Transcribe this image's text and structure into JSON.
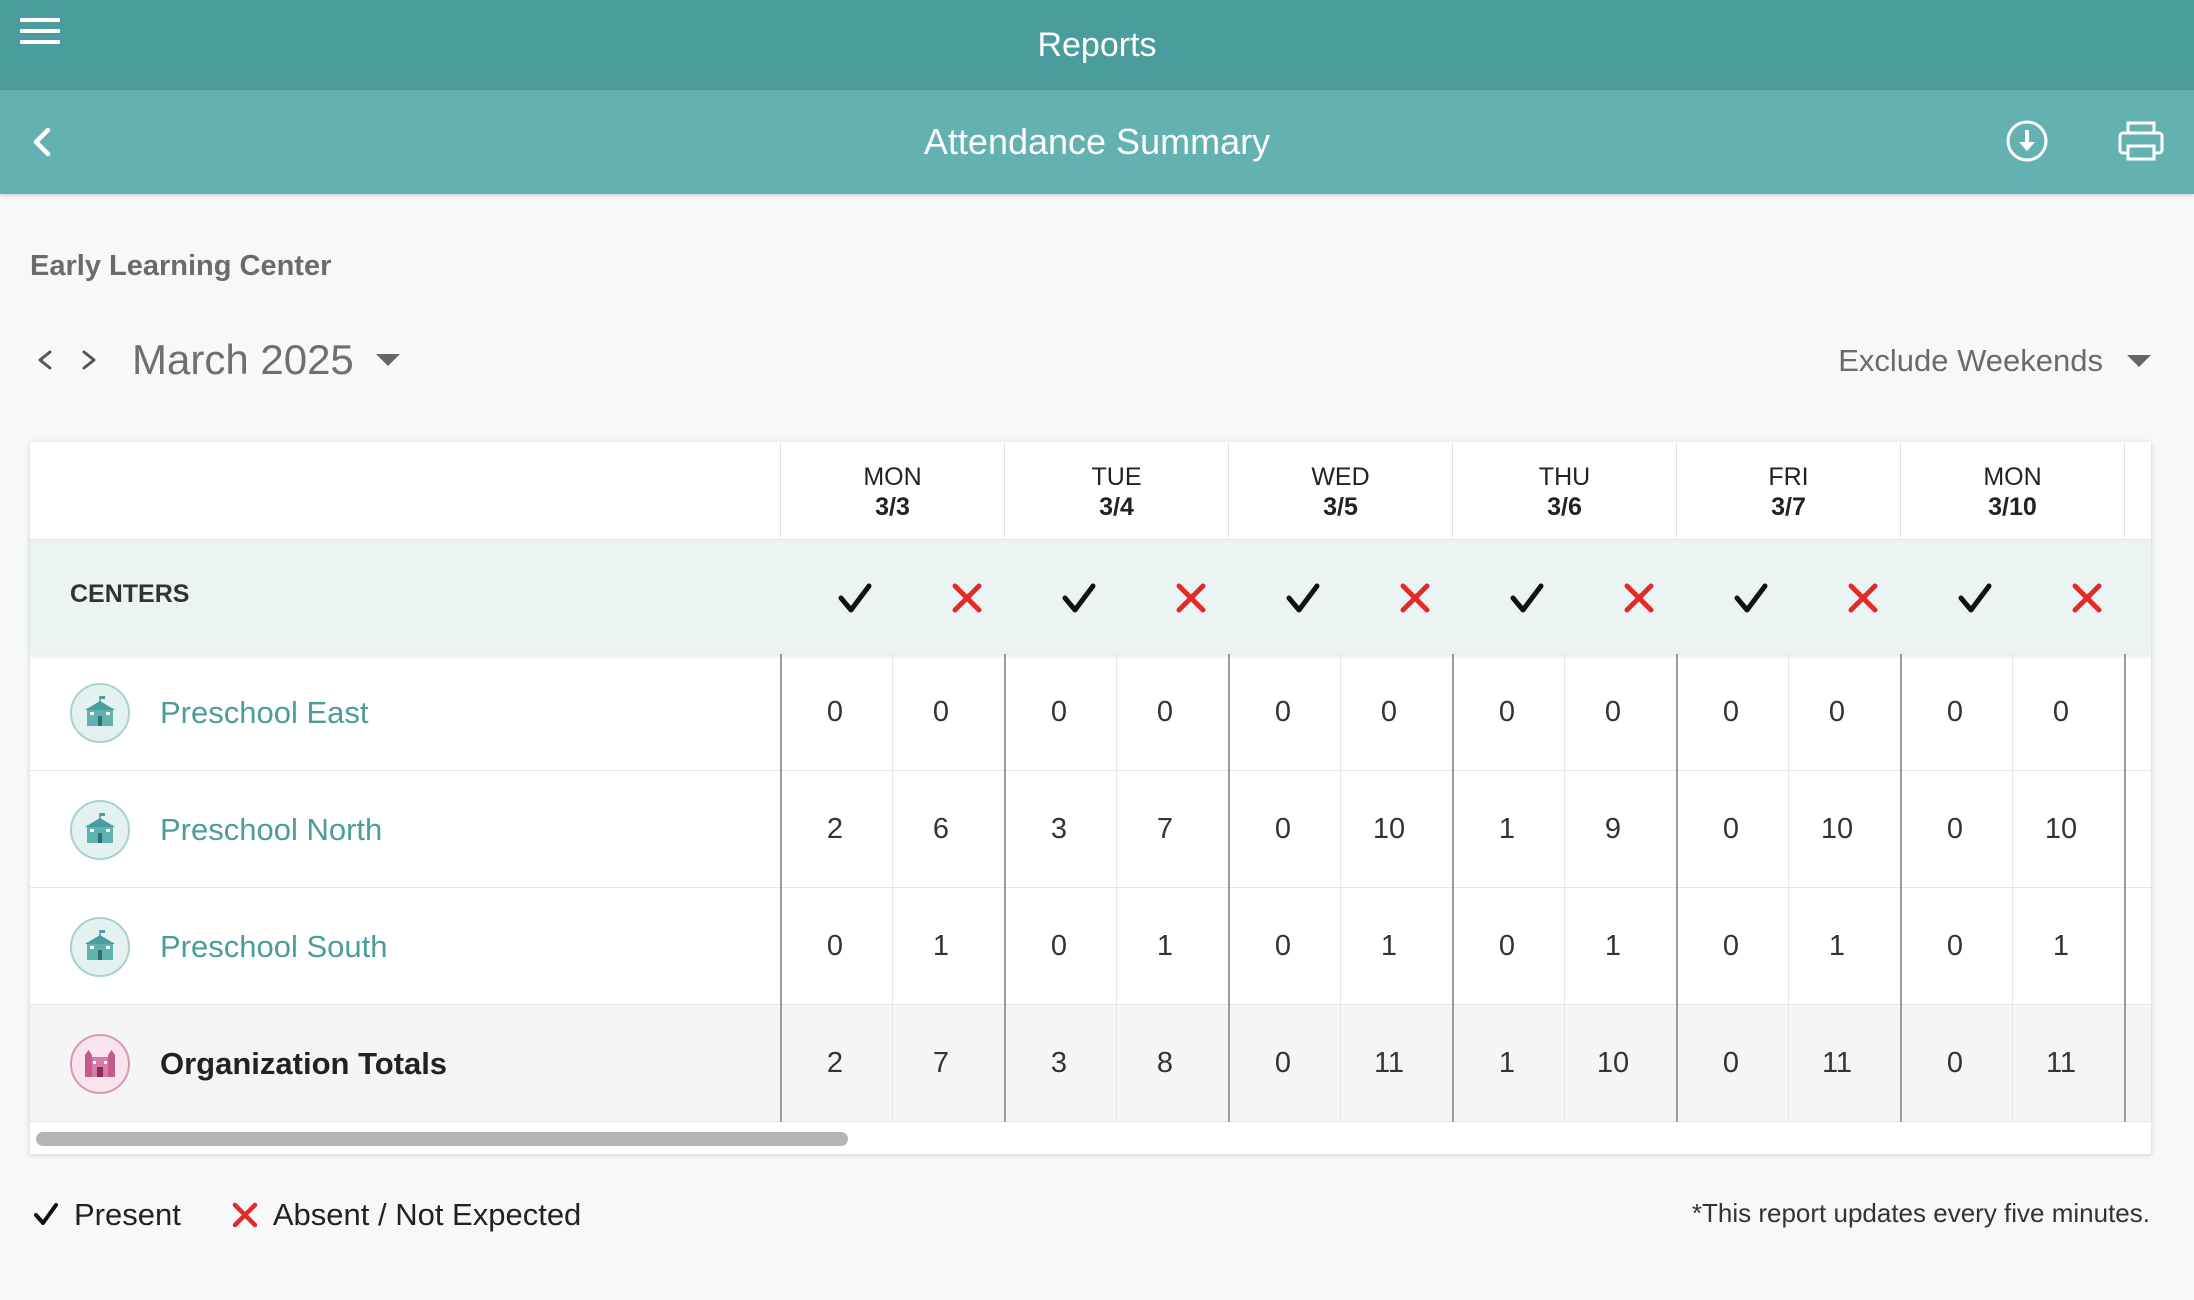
{
  "app": {
    "title": "Reports"
  },
  "header": {
    "title": "Attendance Summary"
  },
  "organization": {
    "name": "Early Learning Center"
  },
  "period": {
    "month": "March 2025"
  },
  "filter": {
    "selected": "Exclude Weekends"
  },
  "table": {
    "centers_label": "CENTERS",
    "days": [
      {
        "dow": "MON",
        "date": "3/3"
      },
      {
        "dow": "TUE",
        "date": "3/4"
      },
      {
        "dow": "WED",
        "date": "3/5"
      },
      {
        "dow": "THU",
        "date": "3/6"
      },
      {
        "dow": "FRI",
        "date": "3/7"
      },
      {
        "dow": "MON",
        "date": "3/10"
      }
    ],
    "rows": [
      {
        "name": "Preschool East",
        "icon": "school-building-icon",
        "values": [
          "0",
          "0",
          "0",
          "0",
          "0",
          "0",
          "0",
          "0",
          "0",
          "0",
          "0",
          "0"
        ]
      },
      {
        "name": "Preschool North",
        "icon": "school-building-icon",
        "values": [
          "2",
          "6",
          "3",
          "7",
          "0",
          "10",
          "1",
          "9",
          "0",
          "10",
          "0",
          "10"
        ]
      },
      {
        "name": "Preschool South",
        "icon": "school-building-icon",
        "values": [
          "0",
          "1",
          "0",
          "1",
          "0",
          "1",
          "0",
          "1",
          "0",
          "1",
          "0",
          "1"
        ]
      },
      {
        "name": "Organization Totals",
        "icon": "castle-icon",
        "values": [
          "2",
          "7",
          "3",
          "8",
          "0",
          "11",
          "1",
          "10",
          "0",
          "11",
          "0",
          "11"
        ]
      }
    ]
  },
  "legend": {
    "present": "Present",
    "absent": "Absent / Not Expected"
  },
  "footnote": "*This report updates every five minutes.",
  "colors": {
    "primary": "#4a9d9c",
    "secondary": "#64b1b2",
    "absent_red": "#e02b2b",
    "link_teal": "#4a9d9c"
  }
}
